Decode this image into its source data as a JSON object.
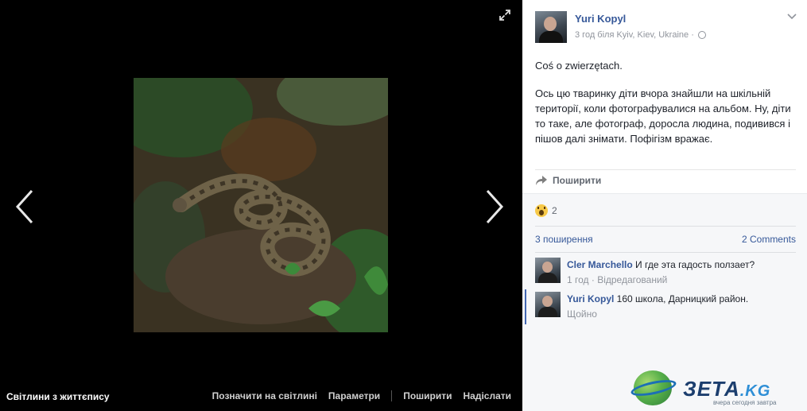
{
  "theater": {
    "album_title": "Світлини з життєпису",
    "actions": [
      "Позначити на світлині",
      "Параметри",
      "Поширити",
      "Надіслати"
    ],
    "photo_subject": "snake-photo"
  },
  "post": {
    "author": "Yuri Kopyl",
    "meta": "3 год біля Kyiv, Kiev, Ukraine ·",
    "paragraph1": "Coś o zwierzętach.",
    "paragraph2": "Ось цю тваринку діти вчора знайшли на шкільній території, коли фотографувалися на альбом. Ну, діти то таке, але фотограф, доросла людина, подивився і пішов далі знімати. Пофігізм вражає.",
    "share_label": "Поширити"
  },
  "feedback": {
    "reaction_count": "2",
    "shares": "3 поширення",
    "comments": "2 Comments"
  },
  "comments": [
    {
      "author": "Cler Marchello",
      "text": " И где эта гадость ползает?",
      "time": "1 год",
      "extra": " · Відредагований"
    },
    {
      "author": "Yuri Kopyl",
      "text": " 160 школа, Дарницкий район.",
      "time": "Щойно",
      "extra": ""
    }
  ],
  "watermark": {
    "brand": "ЗЕТА",
    "tld": ".KG",
    "tagline": "вчера сегодня завтра"
  }
}
